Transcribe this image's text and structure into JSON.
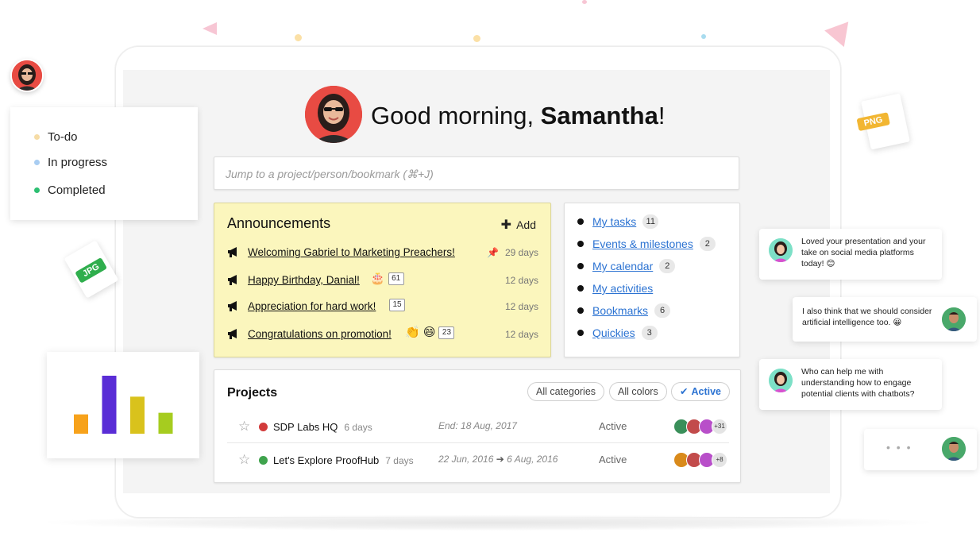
{
  "greeting": {
    "prefix": "Good morning, ",
    "name": "Samantha",
    "suffix": "!"
  },
  "search": {
    "placeholder": "Jump to a project/person/bookmark (⌘+J)"
  },
  "announcements": {
    "title": "Announcements",
    "add_label": "Add",
    "items": [
      {
        "text": "Welcoming Gabriel to Marketing Preachers!",
        "days": "29 days",
        "pinned": true
      },
      {
        "text": "Happy Birthday, Danial!",
        "emoji": "🎂",
        "count": "61",
        "days": "12 days"
      },
      {
        "text": "Appreciation for hard work!",
        "count": "15",
        "days": "12 days"
      },
      {
        "text": "Congratulations on promotion!",
        "emoji": "👏 😄",
        "count": "23",
        "days": "12 days"
      }
    ]
  },
  "quick_links": [
    {
      "label": "My tasks",
      "count": "11"
    },
    {
      "label": "Events & milestones",
      "count": "2"
    },
    {
      "label": "My calendar",
      "count": "2"
    },
    {
      "label": "My activities",
      "count": ""
    },
    {
      "label": "Bookmarks",
      "count": "6"
    },
    {
      "label": "Quickies",
      "count": "3"
    }
  ],
  "projects": {
    "title": "Projects",
    "filters": {
      "categories": "All categories",
      "colors": "All colors",
      "active": "Active"
    },
    "rows": [
      {
        "name": "SDP Labs HQ",
        "age": "6 days",
        "dates": "End: 18 Aug, 2017",
        "status": "Active",
        "more": "+31",
        "color": "#d23b3b"
      },
      {
        "name": "Let's Explore ProofHub",
        "age": "7 days",
        "date_start": "22 Jun, 2016",
        "date_end": "6 Aug, 2016",
        "status": "Active",
        "more": "+8",
        "color": "#3fa34d"
      }
    ]
  },
  "legend": {
    "items": [
      {
        "label": "To-do",
        "color": "#f6dca6"
      },
      {
        "label": "In progress",
        "color": "#a9cdf2"
      },
      {
        "label": "Completed",
        "color": "#2dbf72"
      }
    ]
  },
  "files": {
    "png": "PNG",
    "jpg": "JPG"
  },
  "chart_data": {
    "type": "bar",
    "values": [
      24,
      72,
      46,
      26
    ],
    "colors": [
      "#f7a21b",
      "#5a2dd6",
      "#d9c21c",
      "#a6cc1f"
    ]
  },
  "chats": [
    {
      "text": "Loved your presentation and your take on social media platforms today! 😊"
    },
    {
      "text": "I also think that we should consider artificial intelligence too. 😀"
    },
    {
      "text": "Who can help me with understanding how to engage potential clients with chatbots?"
    },
    {
      "text": "• • •"
    }
  ]
}
